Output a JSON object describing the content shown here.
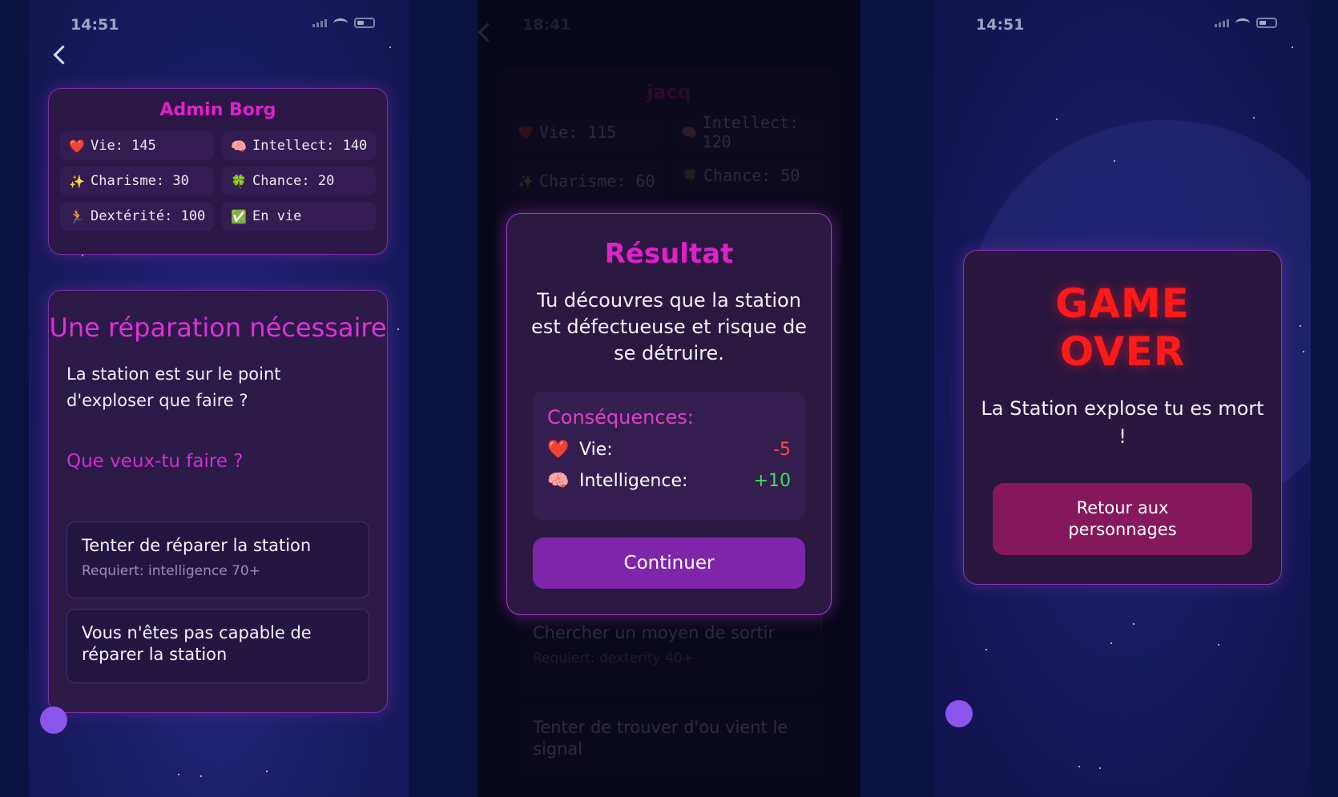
{
  "screen1": {
    "status_time": "14:51",
    "character_name": "Admin Borg",
    "stats": [
      {
        "icon": "heart-icon",
        "glyph": "❤️",
        "label": "Vie: 145"
      },
      {
        "icon": "brain-icon",
        "glyph": "🧠",
        "label": "Intellect: 140"
      },
      {
        "icon": "sparkles-icon",
        "glyph": "✨",
        "label": "Charisme: 30"
      },
      {
        "icon": "clover-icon",
        "glyph": "🍀",
        "label": "Chance: 20"
      },
      {
        "icon": "runner-icon",
        "glyph": "🏃",
        "label": "Dextérité: 100"
      },
      {
        "icon": "check-icon",
        "glyph": "✅",
        "label": "En vie"
      }
    ],
    "event_title": "Une réparation nécessaire",
    "event_description": "La station est sur le point d'exploser que faire ?",
    "question": "Que veux-tu faire ?",
    "options": [
      {
        "text": "Tenter de réparer la station",
        "requirement": "Requiert: intelligence 70+"
      },
      {
        "text": "Vous n'êtes pas capable de réparer la station",
        "requirement": ""
      }
    ]
  },
  "screen2": {
    "status_time": "18:41",
    "character_name": "jacq",
    "stats": [
      {
        "icon": "heart-icon",
        "glyph": "❤️",
        "label": "Vie: 115"
      },
      {
        "icon": "brain-icon",
        "glyph": "🧠",
        "label": "Intellect: 120"
      },
      {
        "icon": "sparkles-icon",
        "glyph": "✨",
        "label": "Charisme: 60"
      },
      {
        "icon": "clover-icon",
        "glyph": "🍀",
        "label": "Chance: 50"
      }
    ],
    "background_options": [
      {
        "text": "Chercher un moyen de sortir",
        "requirement": "Requiert: dexterity 40+"
      },
      {
        "text": "Tenter de trouver d'ou vient le signal",
        "requirement": ""
      }
    ],
    "modal": {
      "title": "Résultat",
      "body": "Tu découvres que la station est défectueuse et risque de se détruire.",
      "consequences_title": "Conséquences:",
      "consequences": [
        {
          "icon": "heart-icon",
          "glyph": "❤️",
          "label": "Vie:",
          "value": "-5",
          "tone": "neg"
        },
        {
          "icon": "brain-icon",
          "glyph": "🧠",
          "label": "Intelligence:",
          "value": "+10",
          "tone": "pos"
        }
      ],
      "button_label": "Continuer"
    }
  },
  "screen3": {
    "status_time": "14:51",
    "title": "GAME OVER",
    "message": "La Station explose tu es mort !",
    "button_label": "Retour aux personnages"
  },
  "colors": {
    "accent_magenta": "#e020c8",
    "card_bg": "#2a1746",
    "primary_button": "#7e25aa",
    "danger_red": "#ff1a1a",
    "back_button": "#85185a"
  }
}
